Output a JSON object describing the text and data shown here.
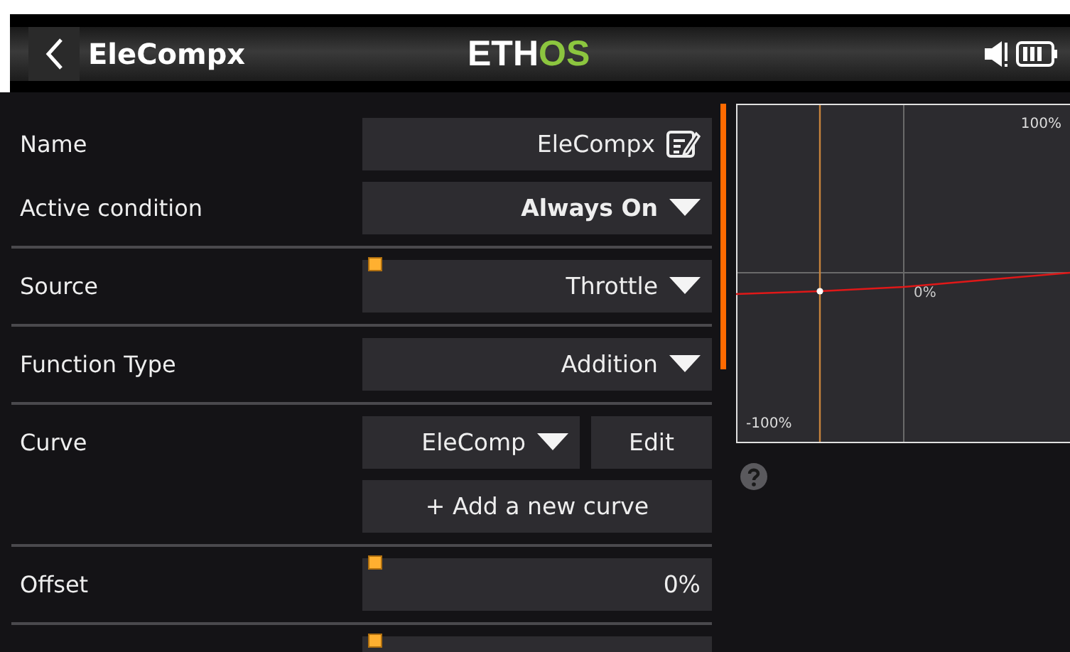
{
  "header": {
    "title": "EleCompx",
    "logo_parts": [
      {
        "text": "ETH",
        "color": "#ffffff"
      },
      {
        "text": "OS",
        "color": "#8cc63f"
      }
    ]
  },
  "groups": [
    {
      "rows": [
        {
          "label": "Name",
          "kind": "text",
          "value": "EleCompx",
          "marker": false
        },
        {
          "label": "Active condition",
          "kind": "dropdown",
          "value": "Always On",
          "bold": true,
          "marker": false
        }
      ]
    },
    {
      "rows": [
        {
          "label": "Source",
          "kind": "dropdown",
          "value": "Throttle",
          "marker": true
        }
      ]
    },
    {
      "rows": [
        {
          "label": "Function Type",
          "kind": "dropdown",
          "value": "Addition",
          "marker": false
        }
      ]
    },
    {
      "rows": [
        {
          "label": "Curve",
          "kind": "curve",
          "value": "EleComp",
          "button": "Edit",
          "marker": false
        },
        {
          "kind": "button",
          "value": "+ Add a new curve",
          "marker": false
        }
      ]
    },
    {
      "rows": [
        {
          "label": "Offset",
          "kind": "value",
          "value": "0%",
          "marker": true
        }
      ]
    },
    {
      "rows": [
        {
          "kind": "value",
          "marker": true
        }
      ]
    }
  ],
  "graph": {
    "top_label": "100%",
    "center_label": "0%",
    "bottom_label": "-100%"
  }
}
